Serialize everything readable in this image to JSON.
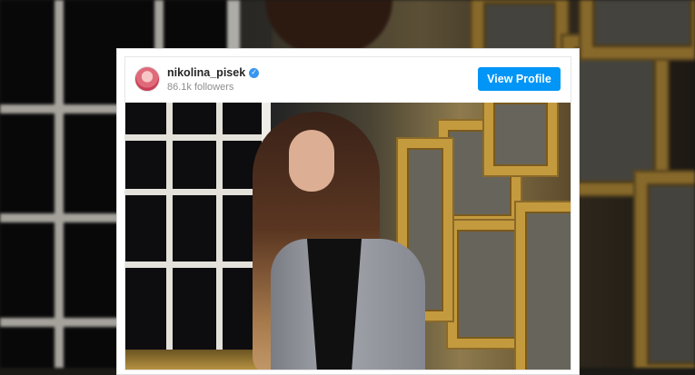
{
  "profile": {
    "username": "nikolina_pisek",
    "followers": "86.1k followers",
    "verified": true,
    "view_profile_label": "View Profile"
  },
  "colors": {
    "button_blue": "#0095f6",
    "verified_blue": "#3897f0",
    "username_text": "#262626",
    "secondary_text": "#8e8e8e"
  },
  "post": {
    "image": "post-photo"
  }
}
